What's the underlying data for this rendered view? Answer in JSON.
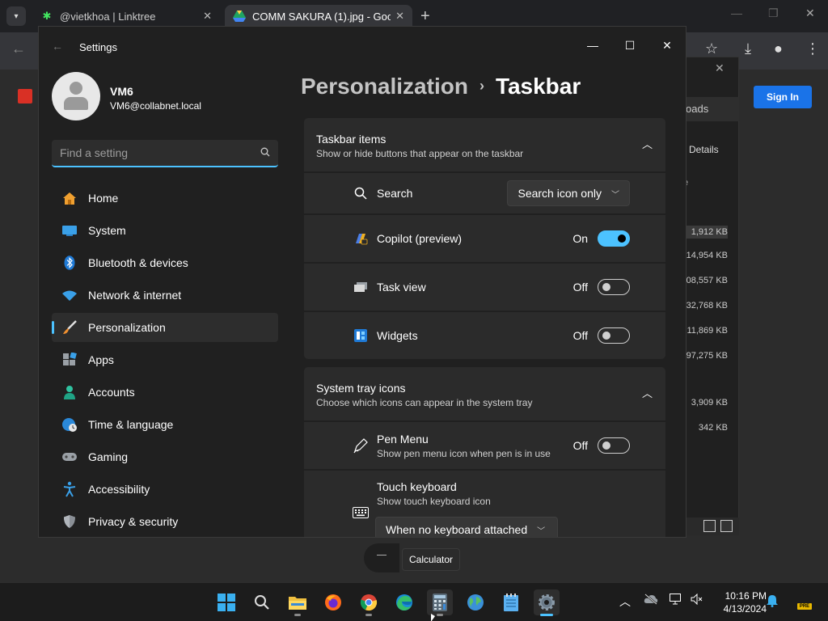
{
  "browser": {
    "tabs": [
      {
        "title": "@vietkhoa | Linktree",
        "favicon": "linktree-icon"
      },
      {
        "title": "COMM SAKURA (1).jpg - Google",
        "favicon": "google-drive-icon"
      }
    ],
    "signin_label": "Sign In",
    "downloads": {
      "tab_label": "oads",
      "details_label": "Details",
      "col_hint": "e",
      "sizes": [
        "1,912 KB",
        "14,954 KB",
        "08,557 KB",
        "32,768 KB",
        "11,869 KB",
        "97,275 KB",
        "3,909 KB",
        "342 KB"
      ]
    }
  },
  "settings": {
    "window_title": "Settings",
    "user": {
      "name": "VM6",
      "email": "VM6@collabnet.local"
    },
    "search_placeholder": "Find a setting",
    "nav": [
      {
        "label": "Home",
        "icon": "home-icon"
      },
      {
        "label": "System",
        "icon": "system-icon"
      },
      {
        "label": "Bluetooth & devices",
        "icon": "bluetooth-icon"
      },
      {
        "label": "Network & internet",
        "icon": "wifi-icon"
      },
      {
        "label": "Personalization",
        "icon": "brush-icon",
        "active": true
      },
      {
        "label": "Apps",
        "icon": "apps-icon"
      },
      {
        "label": "Accounts",
        "icon": "accounts-icon"
      },
      {
        "label": "Time & language",
        "icon": "globe-clock-icon"
      },
      {
        "label": "Gaming",
        "icon": "gamepad-icon"
      },
      {
        "label": "Accessibility",
        "icon": "accessibility-icon"
      },
      {
        "label": "Privacy & security",
        "icon": "shield-icon"
      }
    ],
    "breadcrumb": {
      "parent": "Personalization",
      "current": "Taskbar"
    },
    "taskbar_items": {
      "title": "Taskbar items",
      "subtitle": "Show or hide buttons that appear on the taskbar",
      "search": {
        "label": "Search",
        "value": "Search icon only"
      },
      "copilot": {
        "label": "Copilot (preview)",
        "state": "On"
      },
      "task_view": {
        "label": "Task view",
        "state": "Off"
      },
      "widgets": {
        "label": "Widgets",
        "state": "Off"
      }
    },
    "system_tray": {
      "title": "System tray icons",
      "subtitle": "Choose which icons can appear in the system tray",
      "pen_menu": {
        "label": "Pen Menu",
        "subtitle": "Show pen menu icon when pen is in use",
        "state": "Off"
      },
      "touch_keyboard": {
        "label": "Touch keyboard",
        "subtitle": "Show touch keyboard icon",
        "value": "When no keyboard attached"
      }
    }
  },
  "taskbar": {
    "tooltip": "Calculator",
    "apps": [
      "start-icon",
      "search-icon",
      "file-explorer-icon",
      "firefox-icon",
      "chrome-icon",
      "edge-icon",
      "calculator-icon",
      "globe-app-icon",
      "notepad-icon",
      "settings-icon"
    ],
    "time": "10:16 PM",
    "date": "4/13/2024",
    "pre_badge": "PRE"
  },
  "colors": {
    "accent": "#4cc2ff",
    "sign_in": "#1a73e8",
    "window_bg": "#202020",
    "card_bg": "#2b2b2b"
  }
}
